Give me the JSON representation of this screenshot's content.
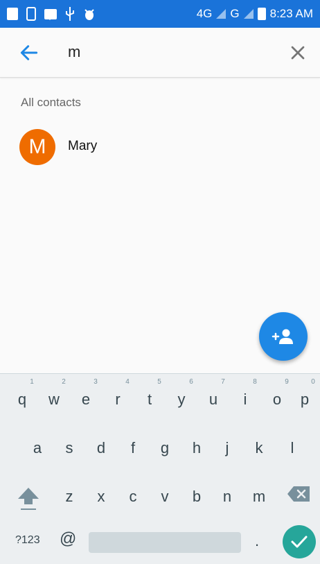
{
  "status_bar": {
    "network_1": "4G",
    "network_2": "G",
    "time": "8:23 AM"
  },
  "search": {
    "query": "m",
    "back_icon": "arrow-left-icon",
    "clear_icon": "close-icon"
  },
  "results": {
    "section_label": "All contacts",
    "contacts": [
      {
        "initial": "M",
        "name": "Mary",
        "avatar_color": "#ef6c00"
      }
    ]
  },
  "fab": {
    "icon": "add-person-icon",
    "color": "#1e88e5"
  },
  "keyboard": {
    "row1": [
      "q",
      "w",
      "e",
      "r",
      "t",
      "y",
      "u",
      "i",
      "o",
      "p"
    ],
    "row1_hints": [
      "1",
      "2",
      "3",
      "4",
      "5",
      "6",
      "7",
      "8",
      "9",
      "0"
    ],
    "row2": [
      "a",
      "s",
      "d",
      "f",
      "g",
      "h",
      "j",
      "k",
      "l"
    ],
    "row3": [
      "z",
      "x",
      "c",
      "v",
      "b",
      "n",
      "m"
    ],
    "symbols_label": "?123",
    "at_label": "@",
    "period_label": ".",
    "enter_icon": "checkmark-icon",
    "enter_color": "#26a69a"
  }
}
